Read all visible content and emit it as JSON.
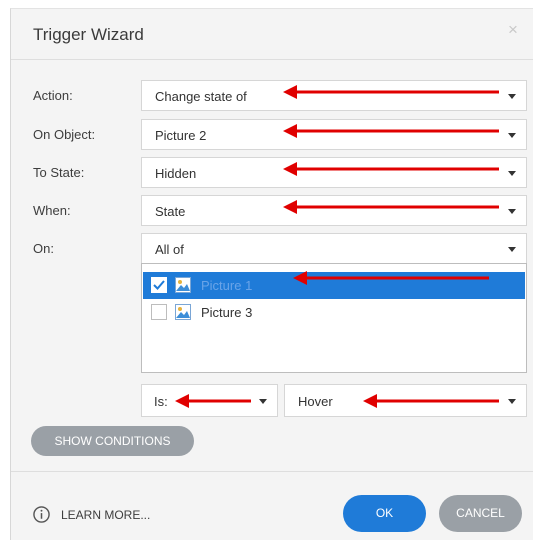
{
  "dialog": {
    "title": "Trigger Wizard",
    "close_icon": "close-icon"
  },
  "form": {
    "action": {
      "label": "Action:",
      "value": "Change state of"
    },
    "on_object": {
      "label": "On Object:",
      "value": "Picture 2"
    },
    "to_state": {
      "label": "To State:",
      "value": "Hidden"
    },
    "when": {
      "label": "When:",
      "value": "State"
    },
    "on": {
      "label": "On:",
      "value": "All of"
    }
  },
  "object_list": [
    {
      "label": "Picture 1",
      "checked": true,
      "selected": true,
      "icon": "picture-icon"
    },
    {
      "label": "Picture 3",
      "checked": false,
      "selected": false,
      "icon": "picture-icon"
    }
  ],
  "condition": {
    "operator": "Is:",
    "state": "Hover"
  },
  "buttons": {
    "show_conditions": "SHOW CONDITIONS",
    "learn_more": "LEARN MORE...",
    "ok": "OK",
    "cancel": "CANCEL"
  },
  "colors": {
    "accent": "#1f7bd8",
    "annotation_arrow": "#e00000",
    "secondary_button": "#9aa0a6"
  }
}
